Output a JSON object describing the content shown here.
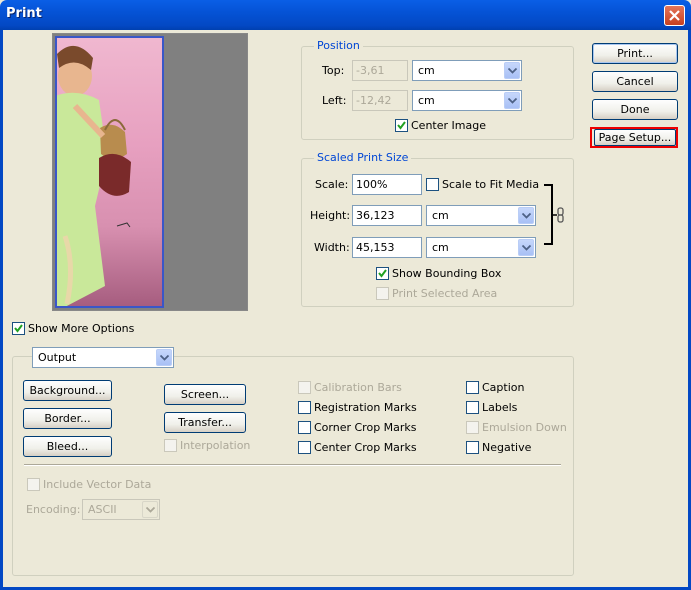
{
  "window": {
    "title": "Print"
  },
  "position": {
    "legend": "Position",
    "top_label": "Top:",
    "top_value": "-3,61",
    "top_unit": "cm",
    "left_label": "Left:",
    "left_value": "-12,42",
    "left_unit": "cm",
    "center_image": "Center Image"
  },
  "scaled": {
    "legend": "Scaled Print Size",
    "scale_label": "Scale:",
    "scale_value": "100%",
    "scale_to_fit": "Scale to Fit Media",
    "height_label": "Height:",
    "height_value": "36,123",
    "height_unit": "cm",
    "width_label": "Width:",
    "width_value": "45,153",
    "width_unit": "cm",
    "show_bounding_box": "Show Bounding Box",
    "print_selected_area": "Print Selected Area"
  },
  "buttons": {
    "print": "Print...",
    "cancel": "Cancel",
    "done": "Done",
    "page_setup": "Page Setup..."
  },
  "show_more_options": "Show More Options",
  "output": {
    "dropdown": "Output",
    "background": "Background...",
    "border": "Border...",
    "bleed": "Bleed...",
    "screen": "Screen...",
    "transfer": "Transfer...",
    "interpolation": "Interpolation",
    "calibration_bars": "Calibration Bars",
    "registration_marks": "Registration Marks",
    "corner_crop_marks": "Corner Crop Marks",
    "center_crop_marks": "Center Crop Marks",
    "caption": "Caption",
    "labels": "Labels",
    "emulsion_down": "Emulsion Down",
    "negative": "Negative",
    "include_vector_data": "Include Vector Data",
    "encoding_label": "Encoding:",
    "encoding_value": "ASCII"
  },
  "colors": {
    "titlebar": "#0553d6",
    "highlight": "#e00000",
    "legend": "#0046d5"
  }
}
